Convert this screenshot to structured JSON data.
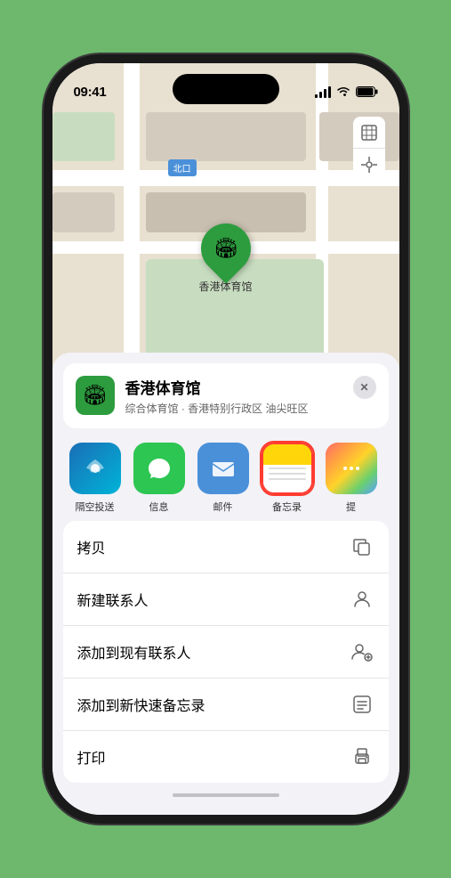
{
  "status": {
    "time": "09:41",
    "location_arrow": "▶"
  },
  "map": {
    "north_exit": "北口",
    "controls": {
      "map_icon": "🗺",
      "location_icon": "⌖"
    }
  },
  "pin": {
    "label": "香港体育馆",
    "emoji": "🏟"
  },
  "venue_card": {
    "name": "香港体育馆",
    "subtitle": "综合体育馆 · 香港特别行政区 油尖旺区",
    "close": "✕"
  },
  "share_items": [
    {
      "id": "airdrop",
      "label": "隔空投送",
      "type": "airdrop"
    },
    {
      "id": "messages",
      "label": "信息",
      "type": "messages"
    },
    {
      "id": "mail",
      "label": "邮件",
      "type": "mail"
    },
    {
      "id": "notes",
      "label": "备忘录",
      "type": "notes"
    },
    {
      "id": "more",
      "label": "提",
      "type": "more"
    }
  ],
  "actions": [
    {
      "id": "copy",
      "label": "拷贝",
      "icon": "copy"
    },
    {
      "id": "new-contact",
      "label": "新建联系人",
      "icon": "person"
    },
    {
      "id": "add-existing",
      "label": "添加到现有联系人",
      "icon": "person-add"
    },
    {
      "id": "add-note",
      "label": "添加到新快速备忘录",
      "icon": "note"
    },
    {
      "id": "print",
      "label": "打印",
      "icon": "print"
    }
  ]
}
